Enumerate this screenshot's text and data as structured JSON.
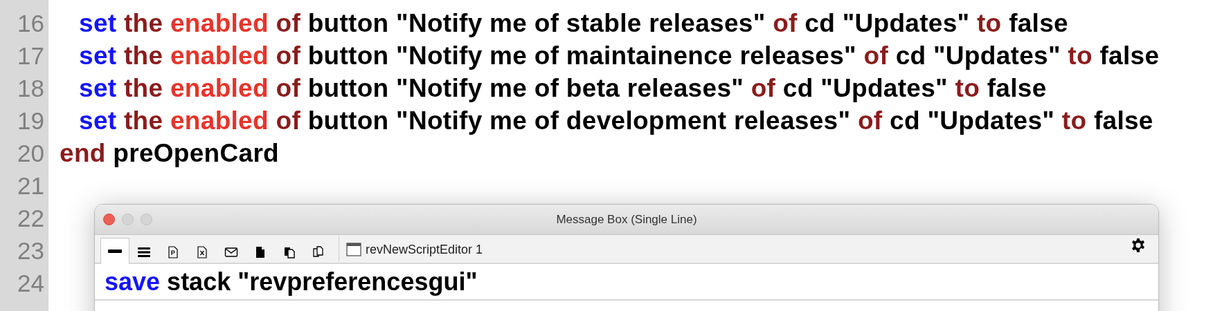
{
  "editor": {
    "lines": [
      {
        "number": "16",
        "indented": true,
        "tokens": [
          {
            "text": "set",
            "kind": "command"
          },
          {
            "text": "the",
            "kind": "keyword"
          },
          {
            "text": "enabled",
            "kind": "property"
          },
          {
            "text": "of",
            "kind": "keyword"
          },
          {
            "text": "button \"Notify me of stable releases\"",
            "kind": "plain"
          },
          {
            "text": "of",
            "kind": "keyword"
          },
          {
            "text": "cd \"Updates\"",
            "kind": "plain"
          },
          {
            "text": "to",
            "kind": "keyword"
          },
          {
            "text": "false",
            "kind": "plain"
          }
        ]
      },
      {
        "number": "17",
        "indented": true,
        "tokens": [
          {
            "text": "set",
            "kind": "command"
          },
          {
            "text": "the",
            "kind": "keyword"
          },
          {
            "text": "enabled",
            "kind": "property"
          },
          {
            "text": "of",
            "kind": "keyword"
          },
          {
            "text": "button \"Notify me of maintainence releases\"",
            "kind": "plain"
          },
          {
            "text": "of",
            "kind": "keyword"
          },
          {
            "text": "cd \"Updates\"",
            "kind": "plain"
          },
          {
            "text": "to",
            "kind": "keyword"
          },
          {
            "text": "false",
            "kind": "plain"
          }
        ]
      },
      {
        "number": "18",
        "indented": true,
        "tokens": [
          {
            "text": "set",
            "kind": "command"
          },
          {
            "text": "the",
            "kind": "keyword"
          },
          {
            "text": "enabled",
            "kind": "property"
          },
          {
            "text": "of",
            "kind": "keyword"
          },
          {
            "text": "button \"Notify me of beta releases\"",
            "kind": "plain"
          },
          {
            "text": "of",
            "kind": "keyword"
          },
          {
            "text": "cd \"Updates\"",
            "kind": "plain"
          },
          {
            "text": "to",
            "kind": "keyword"
          },
          {
            "text": "false",
            "kind": "plain"
          }
        ]
      },
      {
        "number": "19",
        "indented": true,
        "tokens": [
          {
            "text": "set",
            "kind": "command"
          },
          {
            "text": "the",
            "kind": "keyword"
          },
          {
            "text": "enabled",
            "kind": "property"
          },
          {
            "text": "of",
            "kind": "keyword"
          },
          {
            "text": "button \"Notify me of development releases\"",
            "kind": "plain"
          },
          {
            "text": "of",
            "kind": "keyword"
          },
          {
            "text": "cd \"Updates\"",
            "kind": "plain"
          },
          {
            "text": "to",
            "kind": "keyword"
          },
          {
            "text": "false",
            "kind": "plain"
          }
        ]
      },
      {
        "number": "20",
        "indented": false,
        "tokens": [
          {
            "text": "end",
            "kind": "keyword"
          },
          {
            "text": "preOpenCard",
            "kind": "plain"
          }
        ]
      },
      {
        "number": "21"
      },
      {
        "number": "22"
      },
      {
        "number": "23"
      },
      {
        "number": "24"
      }
    ]
  },
  "message_box": {
    "title": "Message Box (Single Line)",
    "tabs": [
      {
        "kind": "single-line",
        "selected": true
      },
      {
        "kind": "multi-line",
        "selected": false
      },
      {
        "kind": "p-document",
        "selected": false
      },
      {
        "kind": "x-document",
        "selected": false
      },
      {
        "kind": "envelope",
        "selected": false
      },
      {
        "kind": "document",
        "selected": false
      },
      {
        "kind": "documents",
        "selected": false
      },
      {
        "kind": "copy",
        "selected": false
      }
    ],
    "target": {
      "label": "revNewScriptEditor 1"
    },
    "command": {
      "tokens": [
        {
          "text": "save",
          "kind": "command"
        },
        {
          "text": "stack \"revpreferencesgui\"",
          "kind": "plain"
        }
      ]
    }
  }
}
